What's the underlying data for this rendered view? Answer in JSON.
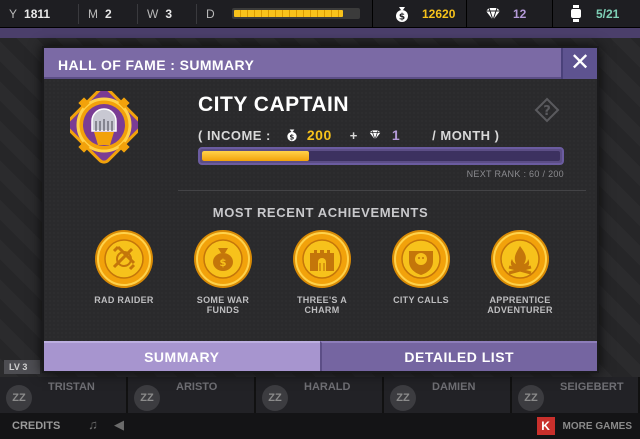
{
  "hud": {
    "year": {
      "key": "Y",
      "value": "1811"
    },
    "month": {
      "key": "M",
      "value": "2"
    },
    "week": {
      "key": "W",
      "value": "3"
    },
    "day": {
      "key": "D",
      "progress": 0.88
    },
    "money": "12620",
    "gems": "12",
    "population": "5/21"
  },
  "colors": {
    "accent": "#7b6aa5",
    "gold": "#f7c21b",
    "violet": "#b49ad8",
    "teal": "#7fd1b7"
  },
  "scene": {
    "level_label": "LV 3"
  },
  "heroes": [
    {
      "name": "TRISTAN",
      "status": "ZZ"
    },
    {
      "name": "ARISTO",
      "status": "ZZ"
    },
    {
      "name": "HARALD",
      "status": "ZZ"
    },
    {
      "name": "DAMIEN",
      "status": "ZZ"
    },
    {
      "name": "SEIGEBERT",
      "status": "ZZ"
    }
  ],
  "footer": {
    "credits": "CREDITS",
    "more_games": "MORE GAMES",
    "more_games_badge": "K"
  },
  "modal": {
    "title": "HALL OF FAME : SUMMARY",
    "close": "✕",
    "rank": {
      "name": "CITY CAPTAIN",
      "income_open": "( INCOME :",
      "income_gold": "200",
      "plus": "+",
      "income_gems": "1",
      "per_month": "/ MONTH )",
      "progress_value": 60,
      "progress_max": 200,
      "next_rank_text": "NEXT RANK : 60 / 200",
      "help": "?"
    },
    "achievements_title": "MOST RECENT ACHIEVEMENTS",
    "achievements": [
      {
        "label": "RAD RAIDER",
        "icon": "raider-emblem-icon"
      },
      {
        "label": "SOME WAR FUNDS",
        "icon": "money-bag-icon"
      },
      {
        "label": "THREE'S A CHARM",
        "icon": "castle-gate-icon"
      },
      {
        "label": "CITY CALLS",
        "icon": "lion-crest-icon"
      },
      {
        "label": "APPRENTICE ADVENTURER",
        "icon": "campfire-icon"
      }
    ],
    "tabs": {
      "summary": "SUMMARY",
      "detailed": "DETAILED LIST"
    }
  }
}
